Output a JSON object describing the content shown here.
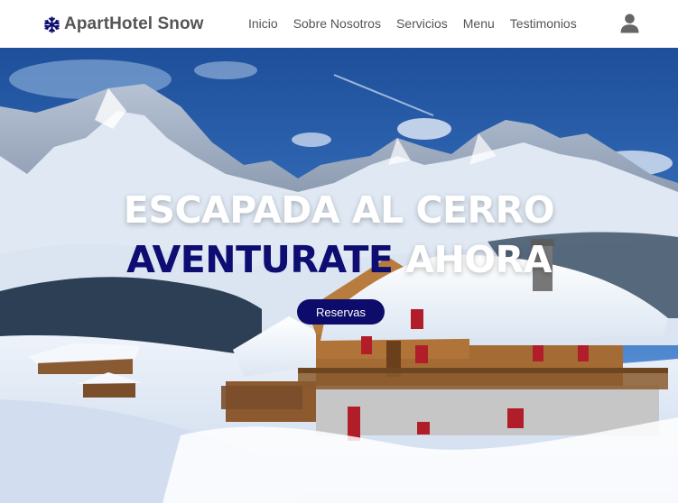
{
  "header": {
    "brand_icon": "snowflake-icon",
    "brand_name": "ApartHotel Snow",
    "nav": [
      "Inicio",
      "Sobre Nosotros",
      "Servicios",
      "Menu",
      "Testimonios"
    ],
    "user_icon": "user-icon"
  },
  "hero": {
    "title_line1": "ESCAPADA AL CERRO",
    "title_accent": "AVENTURATE",
    "title_rest": "AHORA",
    "cta_label": "Reservas",
    "background": "snowy-mountain-chalet-photo"
  },
  "colors": {
    "accent": "#0d0d72",
    "button": "#0e0c6a",
    "header_text": "#555555"
  }
}
